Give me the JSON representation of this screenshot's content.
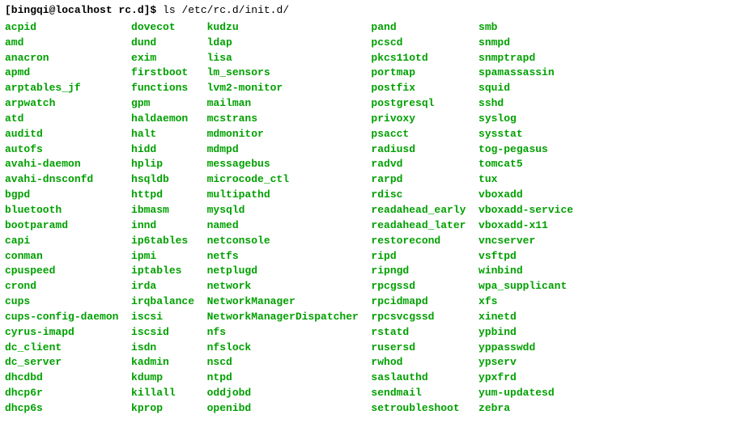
{
  "prompt": "[bingqi@localhost rc.d]$ ",
  "command": "ls /etc/rc.d/init.d/",
  "columns": [
    [
      "acpid",
      "amd",
      "anacron",
      "apmd",
      "arptables_jf",
      "arpwatch",
      "atd",
      "auditd",
      "autofs",
      "avahi-daemon",
      "avahi-dnsconfd",
      "bgpd",
      "bluetooth",
      "bootparamd",
      "capi",
      "conman",
      "cpuspeed",
      "crond",
      "cups",
      "cups-config-daemon",
      "cyrus-imapd",
      "dc_client",
      "dc_server",
      "dhcdbd",
      "dhcp6r",
      "dhcp6s"
    ],
    [
      "dovecot",
      "dund",
      "exim",
      "firstboot",
      "functions",
      "gpm",
      "haldaemon",
      "halt",
      "hidd",
      "hplip",
      "hsqldb",
      "httpd",
      "ibmasm",
      "innd",
      "ip6tables",
      "ipmi",
      "iptables",
      "irda",
      "irqbalance",
      "iscsi",
      "iscsid",
      "isdn",
      "kadmin",
      "kdump",
      "killall",
      "kprop"
    ],
    [
      "kudzu",
      "ldap",
      "lisa",
      "lm_sensors",
      "lvm2-monitor",
      "mailman",
      "mcstrans",
      "mdmonitor",
      "mdmpd",
      "messagebus",
      "microcode_ctl",
      "multipathd",
      "mysqld",
      "named",
      "netconsole",
      "netfs",
      "netplugd",
      "network",
      "NetworkManager",
      "NetworkManagerDispatcher",
      "nfs",
      "nfslock",
      "nscd",
      "ntpd",
      "oddjobd",
      "openibd"
    ],
    [
      "pand",
      "pcscd",
      "pkcs11otd",
      "portmap",
      "postfix",
      "postgresql",
      "privoxy",
      "psacct",
      "radiusd",
      "radvd",
      "rarpd",
      "rdisc",
      "readahead_early",
      "readahead_later",
      "restorecond",
      "ripd",
      "ripngd",
      "rpcgssd",
      "rpcidmapd",
      "rpcsvcgssd",
      "rstatd",
      "rusersd",
      "rwhod",
      "saslauthd",
      "sendmail",
      "setroubleshoot"
    ],
    [
      "smb",
      "snmpd",
      "snmptrapd",
      "spamassassin",
      "squid",
      "sshd",
      "syslog",
      "sysstat",
      "tog-pegasus",
      "tomcat5",
      "tux",
      "vboxadd",
      "vboxadd-service",
      "vboxadd-x11",
      "vncserver",
      "vsftpd",
      "winbind",
      "wpa_supplicant",
      "xfs",
      "xinetd",
      "ypbind",
      "yppasswdd",
      "ypserv",
      "ypxfrd",
      "yum-updatesd",
      "zebra"
    ]
  ]
}
